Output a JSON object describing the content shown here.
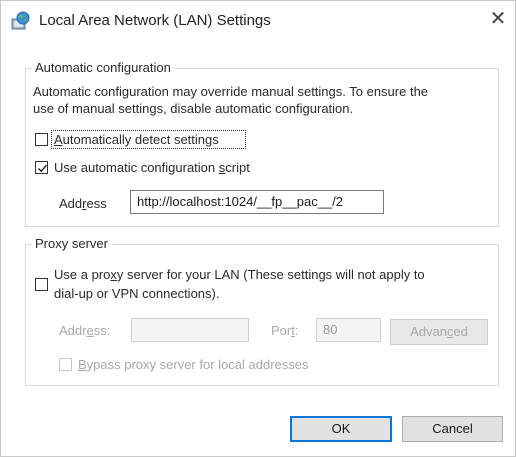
{
  "window": {
    "title": "Local Area Network (LAN) Settings",
    "close_glyph": "✕",
    "icon": "network-globe-icon"
  },
  "auto_config": {
    "group_title": "Automatic configuration",
    "description_line1": "Automatic configuration may override manual settings.  To ensure the",
    "description_line2": "use of manual settings, disable automatic configuration.",
    "detect_settings": {
      "label_accel": "A",
      "label_rest": "utomatically detect settings",
      "checked": false
    },
    "use_script": {
      "label_pre": "Use automatic configuration ",
      "label_accel": "s",
      "label_post": "cript",
      "checked": true
    },
    "address": {
      "label_pre": "Add",
      "label_accel": "r",
      "label_post": "ess",
      "value": "http://localhost:1024/__fp__pac__/2"
    }
  },
  "proxy": {
    "group_title": "Proxy server",
    "use_proxy": {
      "label_line1_pre": "Use a pro",
      "label_line1_accel": "x",
      "label_line1_post": "y server for your LAN (These settings will not apply to",
      "label_line2": "dial-up or VPN connections).",
      "checked": false
    },
    "address_label_pre": "Addr",
    "address_label_accel": "e",
    "address_label_post": "ss:",
    "address_value": "",
    "port_label_pre": "Por",
    "port_label_accel": "t",
    "port_label_post": ":",
    "port_value": "80",
    "advanced_pre": "Advan",
    "advanced_accel": "c",
    "advanced_post": "ed",
    "bypass": {
      "label_accel": "B",
      "label_rest": "ypass proxy server for local addresses",
      "checked": false
    }
  },
  "buttons": {
    "ok": "OK",
    "cancel": "Cancel"
  },
  "colors": {
    "default_button_border": "#0078d7",
    "disabled_text": "#a8a8a8"
  }
}
